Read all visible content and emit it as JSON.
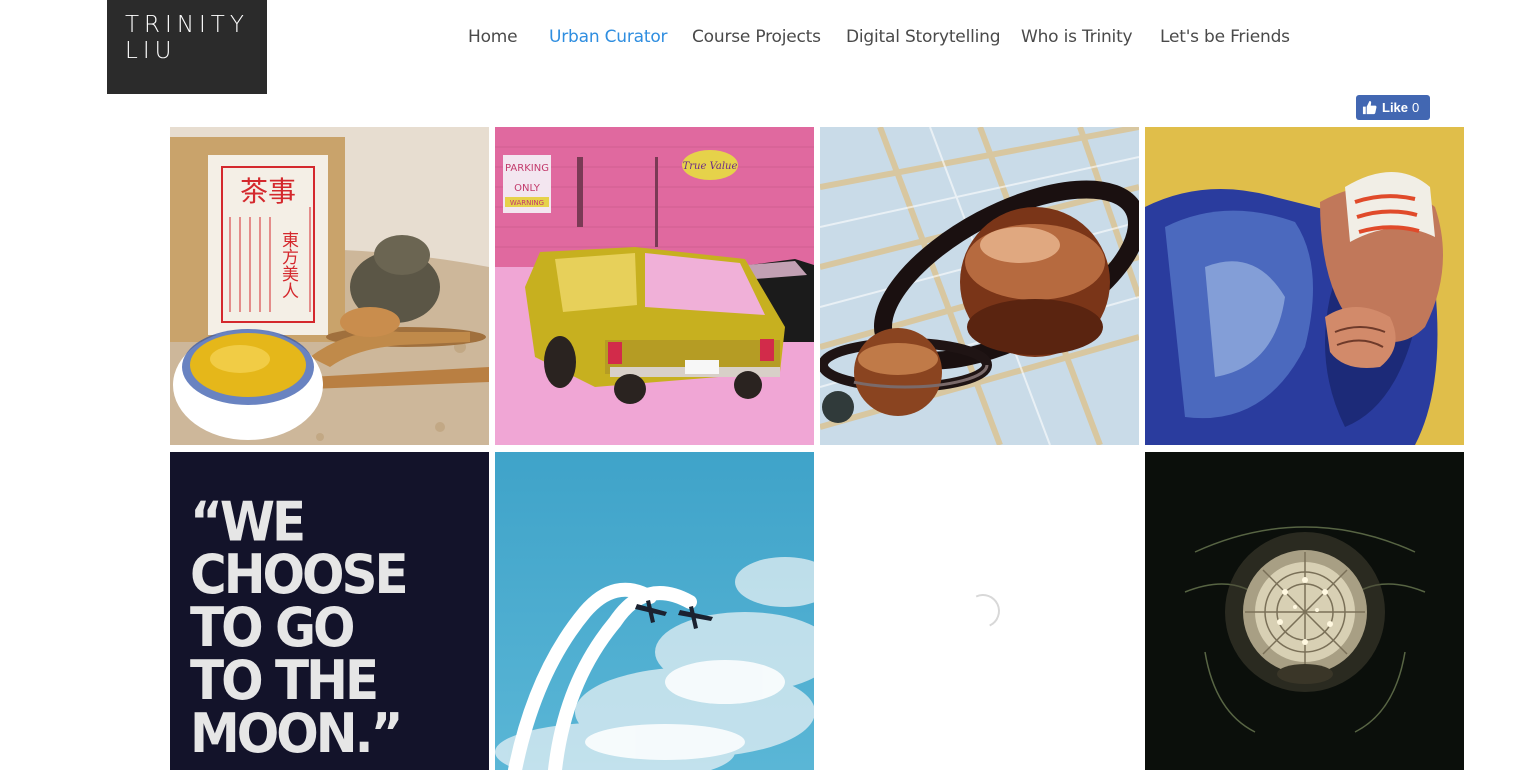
{
  "logo": {
    "line1": "TRINITY",
    "line2": "LIU"
  },
  "nav": {
    "items": [
      {
        "label": "Home",
        "active": false
      },
      {
        "label": "Urban Curator",
        "active": true
      },
      {
        "label": "Course Projects",
        "active": false
      },
      {
        "label": "Digital Storytelling",
        "active": false
      },
      {
        "label": "Who is Trinity",
        "active": false
      },
      {
        "label": "Let's be Friends",
        "active": false
      }
    ]
  },
  "facebook": {
    "label": "Like",
    "count": "0",
    "icon": "thumbs-up-icon"
  },
  "colors": {
    "accent": "#2f8ee0",
    "logo_bg": "#2b2b2b",
    "fb_blue": "#4267b2"
  },
  "gallery": {
    "tea_box": {
      "text_a": "茶事",
      "text_b": "東方美人"
    },
    "moon_quote": {
      "lines": [
        "“WE",
        "CHOOSE",
        "TO GO",
        "TO THE",
        "MOON.”"
      ]
    },
    "parking_sign": {
      "line1": "PARKING",
      "line2": "ONLY",
      "line3": "WARNING"
    },
    "store_sign": "True Value"
  }
}
